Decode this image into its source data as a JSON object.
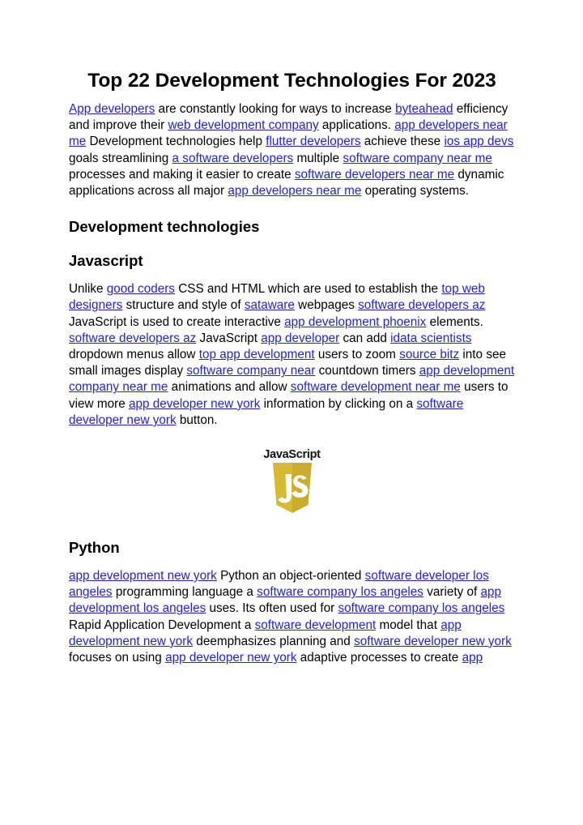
{
  "document": {
    "title": "Top 22 Development Technologies For 2023",
    "link_color": "#2222dd",
    "text_color": "#000000",
    "background_color": "#ffffff"
  },
  "intro_paragraph": {
    "s1": "App developers",
    "s2": " are constantly looking for ways to increase ",
    "s3": "byteahead",
    "s4": " efficiency and improve their ",
    "s5": "web development company",
    "s6": " applications. ",
    "s7": "app developers near me",
    "s8": " Development technologies help ",
    "s9": "flutter developers",
    "s10": " achieve these ",
    "s11": "ios app devs",
    "s12": " goals streamlining ",
    "s13": "a software developers",
    "s14": " multiple ",
    "s15": "software company near me",
    "s16": " processes and making it easier to create ",
    "s17": "software developers near me",
    "s18": " dynamic applications across all major ",
    "s19": "app developers near me",
    "s20": " operating systems."
  },
  "headings": {
    "development_technologies": "Development technologies",
    "javascript": "Javascript",
    "python": "Python"
  },
  "javascript_paragraph": {
    "s1": "Unlike ",
    "s2": "good coders",
    "s3": " CSS and HTML which are used to establish the ",
    "s4": "top web designers",
    "s5": " structure and style of ",
    "s6": "sataware",
    "s7": " webpages ",
    "s8": "software developers az",
    "s9": " JavaScript is used to create interactive ",
    "s10": "app development phoenix",
    "s11": " elements. ",
    "s12": "software developers az",
    "s13": " JavaScript ",
    "s14": "app developer",
    "s15": " can add ",
    "s16": "idata scientists",
    "s17": " dropdown menus allow ",
    "s18": "top app development",
    "s19": " users to zoom ",
    "s20": "source bitz",
    "s21": " into see small images display ",
    "s22": "software company near",
    "s23": " countdown timers ",
    "s24": "app development company near me",
    "s25": " animations and allow ",
    "s26": "software development near me",
    "s27": " users to view more ",
    "s28": "app developer new york",
    "s29": " information by clicking on a ",
    "s30": "software developer new york",
    "s31": " button."
  },
  "javascript_logo": {
    "wordmark": "JavaScript",
    "monogram": "JS",
    "shield_color": "#d6ba32",
    "shield_shadow_color": "#a98f28",
    "monogram_color": "#ffffff"
  },
  "python_paragraph": {
    "s1": "app development new york",
    "s2": " Python an object-oriented ",
    "s3": "software developer los angeles",
    "s4": " programming language a ",
    "s5": "software company los angeles",
    "s6": " variety of ",
    "s7": "app development los angeles",
    "s8": " uses. Its often used for ",
    "s9": "software company los angeles",
    "s10": " Rapid Application Development a ",
    "s11": "software development",
    "s12": " model that ",
    "s13": "app development new york",
    "s14": " deemphasizes planning and ",
    "s15": "software developer new york",
    "s16": " focuses on using ",
    "s17": "app developer new york",
    "s18": " adaptive processes to create ",
    "s19": "app"
  }
}
